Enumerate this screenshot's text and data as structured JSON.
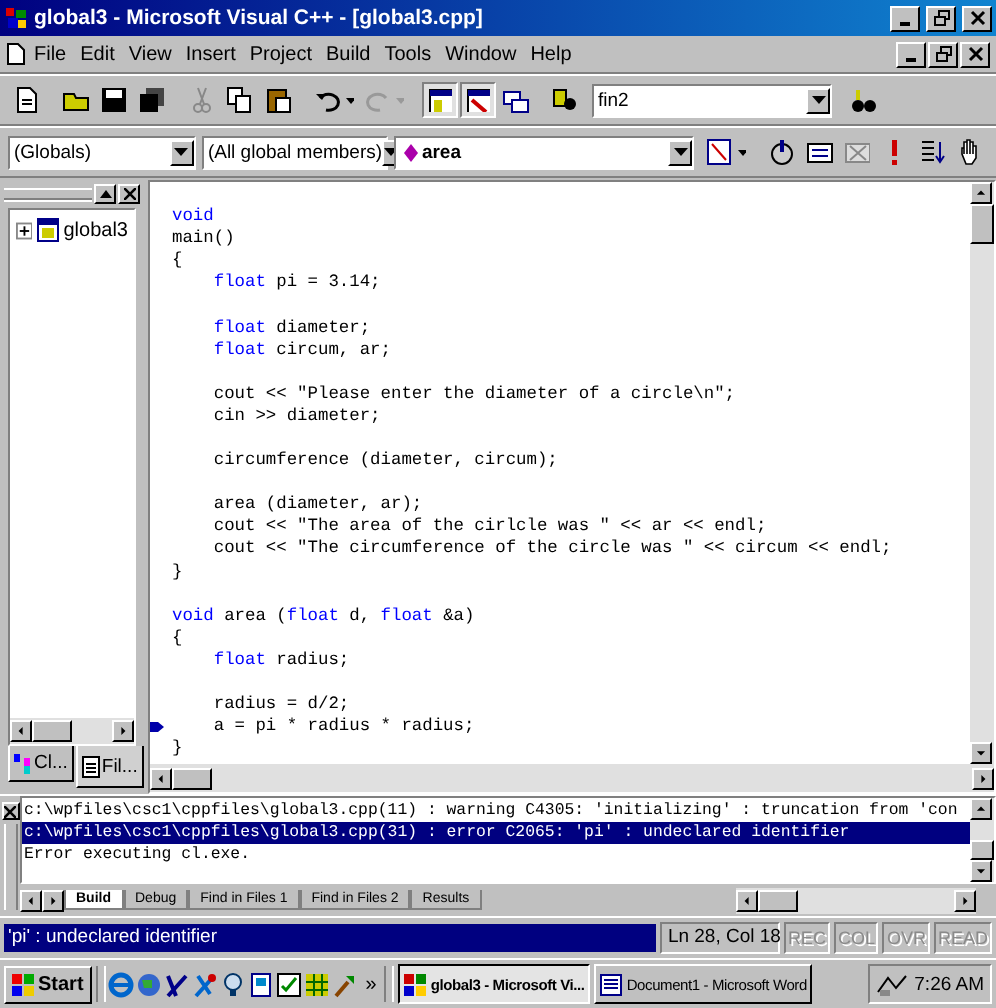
{
  "window": {
    "title": "global3 - Microsoft Visual C++ - [global3.cpp]"
  },
  "menu": [
    "File",
    "Edit",
    "View",
    "Insert",
    "Project",
    "Build",
    "Tools",
    "Window",
    "Help"
  ],
  "toolbar": {
    "find_combo": "fin2"
  },
  "wizard_bar": {
    "class_combo": "(Globals)",
    "members_combo": "(All global members)",
    "function_combo": "area"
  },
  "workspace": {
    "tree": [
      {
        "label": "global3",
        "expanded": false
      }
    ],
    "tabs": [
      {
        "label": "Cl...",
        "selected": false
      },
      {
        "label": "Fil...",
        "selected": true
      }
    ]
  },
  "editor": {
    "lines": [
      {
        "kind": "code",
        "marker": false,
        "segments": [
          {
            "text": "void",
            "keyword": true
          }
        ]
      },
      {
        "kind": "code",
        "marker": false,
        "segments": [
          {
            "text": "main()",
            "keyword": false
          }
        ]
      },
      {
        "kind": "code",
        "marker": false,
        "segments": [
          {
            "text": "{",
            "keyword": false
          }
        ]
      },
      {
        "kind": "code",
        "marker": false,
        "segments": [
          {
            "text": "    float",
            "keyword": true
          },
          {
            "text": " pi = 3.14;",
            "keyword": false
          }
        ]
      },
      {
        "kind": "blank",
        "marker": false
      },
      {
        "kind": "code",
        "marker": false,
        "segments": [
          {
            "text": "    float",
            "keyword": true
          },
          {
            "text": " diameter;",
            "keyword": false
          }
        ]
      },
      {
        "kind": "code",
        "marker": false,
        "segments": [
          {
            "text": "    float",
            "keyword": true
          },
          {
            "text": " circum, ar;",
            "keyword": false
          }
        ]
      },
      {
        "kind": "blank",
        "marker": false
      },
      {
        "kind": "code",
        "marker": false,
        "segments": [
          {
            "text": "    cout << \"Please enter the diameter of a circle\\n\";",
            "keyword": false
          }
        ]
      },
      {
        "kind": "code",
        "marker": false,
        "segments": [
          {
            "text": "    cin >> diameter;",
            "keyword": false
          }
        ]
      },
      {
        "kind": "blank",
        "marker": false
      },
      {
        "kind": "code",
        "marker": false,
        "segments": [
          {
            "text": "    circumference (diameter, circum);",
            "keyword": false
          }
        ]
      },
      {
        "kind": "blank",
        "marker": false
      },
      {
        "kind": "code",
        "marker": false,
        "segments": [
          {
            "text": "    area (diameter, ar);",
            "keyword": false
          }
        ]
      },
      {
        "kind": "code",
        "marker": false,
        "segments": [
          {
            "text": "    cout << \"The area of the cirlcle was \" << ar << endl;",
            "keyword": false
          }
        ]
      },
      {
        "kind": "code",
        "marker": false,
        "segments": [
          {
            "text": "    cout << \"The circumference of the circle was \" << circum << endl;",
            "keyword": false
          }
        ]
      },
      {
        "kind": "code",
        "marker": false,
        "segments": [
          {
            "text": "}",
            "keyword": false
          }
        ]
      },
      {
        "kind": "blank",
        "marker": false
      },
      {
        "kind": "code",
        "marker": false,
        "segments": [
          {
            "text": "void",
            "keyword": true
          },
          {
            "text": " area (",
            "keyword": false
          },
          {
            "text": "float",
            "keyword": true
          },
          {
            "text": " d, ",
            "keyword": false
          },
          {
            "text": "float",
            "keyword": true
          },
          {
            "text": " &a)",
            "keyword": false
          }
        ]
      },
      {
        "kind": "code",
        "marker": false,
        "segments": [
          {
            "text": "{",
            "keyword": false
          }
        ]
      },
      {
        "kind": "code",
        "marker": false,
        "segments": [
          {
            "text": "    float",
            "keyword": true
          },
          {
            "text": " radius;",
            "keyword": false
          }
        ]
      },
      {
        "kind": "blank",
        "marker": false
      },
      {
        "kind": "code",
        "marker": false,
        "segments": [
          {
            "text": "    radius = d/2;",
            "keyword": false
          }
        ]
      },
      {
        "kind": "code",
        "marker": true,
        "segments": [
          {
            "text": "    a = pi * radius * radius;",
            "keyword": false
          }
        ]
      },
      {
        "kind": "code",
        "marker": false,
        "segments": [
          {
            "text": "}",
            "keyword": false
          }
        ]
      }
    ]
  },
  "output": {
    "lines": [
      {
        "text": "c:\\wpfiles\\csc1\\cppfiles\\global3.cpp(11) : warning C4305: 'initializing' : truncation from 'con",
        "selected": false
      },
      {
        "text": "c:\\wpfiles\\csc1\\cppfiles\\global3.cpp(31) : error C2065: 'pi' : undeclared identifier",
        "selected": true
      },
      {
        "text": "Error executing cl.exe.",
        "selected": false
      }
    ],
    "tabs": [
      {
        "label": "Build",
        "selected": true
      },
      {
        "label": "Debug",
        "selected": false
      },
      {
        "label": "Find in Files 1",
        "selected": false
      },
      {
        "label": "Find in Files 2",
        "selected": false
      },
      {
        "label": "Results",
        "selected": false
      }
    ]
  },
  "status_bar": {
    "message": "'pi' : undeclared identifier",
    "position": "Ln 28, Col 18",
    "indicators": [
      {
        "label": "REC",
        "disabled": true
      },
      {
        "label": "COL",
        "disabled": true
      },
      {
        "label": "OVR",
        "disabled": true
      },
      {
        "label": "READ",
        "disabled": true
      }
    ]
  },
  "taskbar": {
    "start": "Start",
    "quick_launch_more": "»",
    "tasks": [
      {
        "label": "global3 - Microsoft Vi...",
        "selected": true
      },
      {
        "label": "Document1 - Microsoft Word",
        "selected": false
      }
    ],
    "clock": "7:26 AM"
  }
}
